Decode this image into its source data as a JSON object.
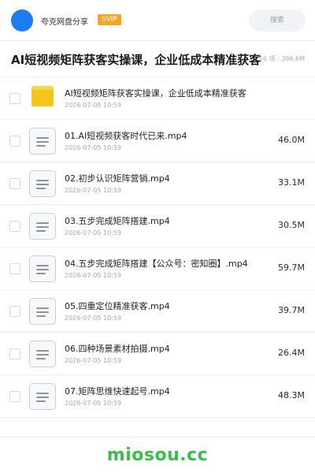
{
  "header": {
    "brand": "夸克网盘分享",
    "badge": "SVIP",
    "search_placeholder": "搜索"
  },
  "folder": {
    "title": "AI短视频矩阵获客实操课，企业低成本精准获客",
    "meta": "16 项 · 396.6M"
  },
  "files": [
    {
      "name": "AI短视频矩阵获客实操课，企业低成本精准获客",
      "date": "2026-07-05 10:59",
      "size": "",
      "type": "folder"
    },
    {
      "name": "01.AI短视频获客时代已来.mp4",
      "date": "2026-07-05 10:59",
      "size": "46.0M",
      "type": "file"
    },
    {
      "name": "02.初步认识矩阵营销.mp4",
      "date": "2026-07-05 10:59",
      "size": "33.1M",
      "type": "file"
    },
    {
      "name": "03.五步完成矩阵搭建.mp4",
      "date": "2026-07-05 10:59",
      "size": "30.5M",
      "type": "file"
    },
    {
      "name": "04.五步完成矩阵搭建【公众号：密知圈】.mp4",
      "date": "2026-07-05 10:59",
      "size": "59.7M",
      "type": "file"
    },
    {
      "name": "05.四重定位精准获客.mp4",
      "date": "2026-07-05 10:59",
      "size": "39.7M",
      "type": "file"
    },
    {
      "name": "06.四种场景素材拍摄.mp4",
      "date": "2026-07-05 10:59",
      "size": "26.4M",
      "type": "file"
    },
    {
      "name": "07.矩阵思维快速起号.mp4",
      "date": "2026-07-05 10:59",
      "size": "48.3M",
      "type": "file"
    }
  ],
  "watermark": "miosou.cc",
  "colors": {
    "accent": "#1e7bf2",
    "badge": "#f5a524",
    "folder": "#f5c51b",
    "watermark": "#3bbd4a"
  },
  "icons": {
    "folder": "folder-icon",
    "file": "document-icon"
  }
}
